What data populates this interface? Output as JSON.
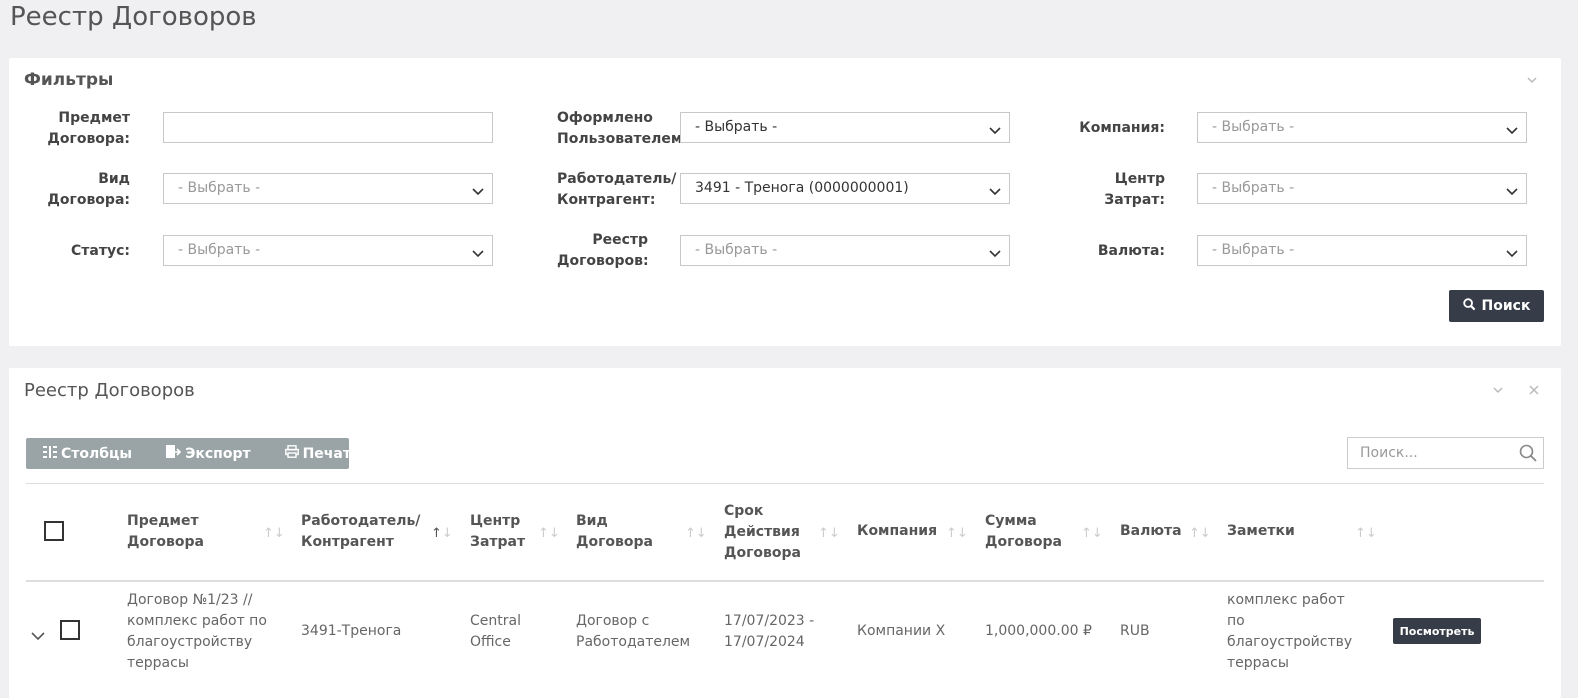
{
  "page": {
    "title": "Реестр Договоров"
  },
  "filters": {
    "title": "Фильтры",
    "subject_label_1": "Предмет",
    "subject_label_2": "Договора:",
    "subject_value": "",
    "type_label_1": "Вид",
    "type_label_2": "Договора:",
    "type_value": "- Выбрать -",
    "status_label": "Статус:",
    "status_value": "- Выбрать -",
    "created_by_label_1": "Оформлено",
    "created_by_label_2": "Пользователем",
    "created_by_value": "- Выбрать -",
    "employer_label_1": "Работодатель/",
    "employer_label_2": "Контрагент:",
    "employer_value": "3491 - Тренога (0000000001)",
    "registry_label_1": "Реестр",
    "registry_label_2": "Договоров:",
    "registry_value": "- Выбрать -",
    "company_label": "Компания:",
    "company_value": "- Выбрать -",
    "cost_center_label_1": "Центр",
    "cost_center_label_2": "Затрат:",
    "cost_center_value": "- Выбрать -",
    "currency_label": "Валюта:",
    "currency_value": "- Выбрать -",
    "search_button": "Поиск"
  },
  "registry": {
    "title": "Реестр Договоров",
    "toolbar": {
      "columns": "Столбцы",
      "export": "Экспорт",
      "print": "Печать"
    },
    "search_placeholder": "Поиск...",
    "columns": {
      "subject_1": "Предмет",
      "subject_2": "Договора",
      "employer_1": "Работодатель/",
      "employer_2": "Контрагент",
      "cost_center_1": "Центр",
      "cost_center_2": "Затрат",
      "type_1": "Вид",
      "type_2": "Договора",
      "term_1": "Срок",
      "term_2": "Действия",
      "term_3": "Договора",
      "company": "Компания",
      "amount_1": "Сумма",
      "amount_2": "Договора",
      "currency": "Валюта",
      "notes": "Заметки"
    },
    "rows": [
      {
        "subject_1": "Договор №1/23 //",
        "subject_2": "комплекс работ по",
        "subject_3": "благоустройству",
        "subject_4": "террасы",
        "employer": "3491-Тренога",
        "cost_center_1": "Central",
        "cost_center_2": "Office",
        "type_1": "Договор с",
        "type_2": "Работодателем",
        "term_1": "17/07/2023 -",
        "term_2": "17/07/2024",
        "company": "Компании X",
        "amount": "1,000,000.00 ₽",
        "currency": "RUB",
        "notes_1": "комплекс работ",
        "notes_2": "по",
        "notes_3": "благоустройству",
        "notes_4": "террасы",
        "view_button": "Посмотреть"
      }
    ]
  },
  "colors": {
    "dark_button": "#373d48",
    "toolbar_bg": "#9aa4a6",
    "page_bg": "#f0f0f2"
  }
}
